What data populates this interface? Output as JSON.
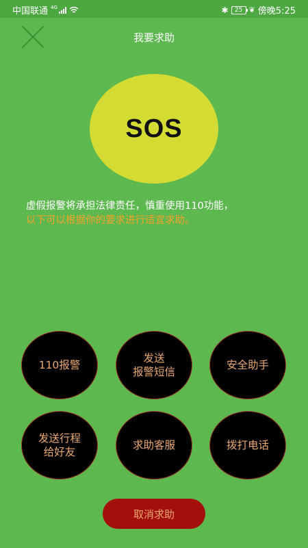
{
  "status_bar": {
    "carrier": "中国联通",
    "network_type": "4G",
    "battery_level": "25",
    "time": "傍晚5:25"
  },
  "header": {
    "title": "我要求助"
  },
  "sos_button": {
    "label": "SOS",
    "color": "#d4dc33"
  },
  "notice": {
    "line1": "虚假报警将承担法律责任，慎重使用110功能，",
    "line2": "以下可以根据你的要求进行适宜求助。"
  },
  "actions": [
    {
      "line1": "110报警",
      "line2": ""
    },
    {
      "line1": "发送",
      "line2": "报警短信"
    },
    {
      "line1": "安全助手",
      "line2": ""
    },
    {
      "line1": "发送行程",
      "line2": "给好友"
    },
    {
      "line1": "求助客服",
      "line2": ""
    },
    {
      "line1": "拨打电话",
      "line2": ""
    }
  ],
  "cancel_button": {
    "label": "取消求助"
  },
  "colors": {
    "background": "#5db84f",
    "statusbar": "#4ea842",
    "notice_highlight": "#f4a12a",
    "action_text": "#e9a86f",
    "cancel_bg": "#a30f0b"
  }
}
